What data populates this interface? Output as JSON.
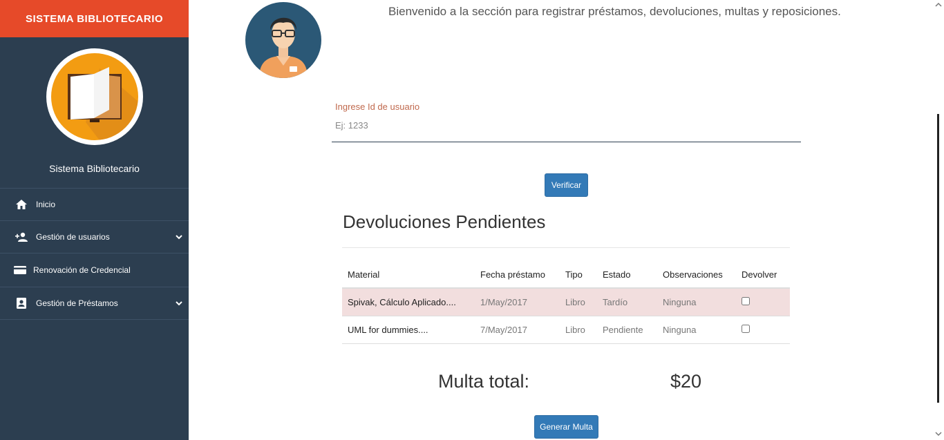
{
  "sidebar": {
    "brand": "SISTEMA BIBLIOTECARIO",
    "title": "Sistema Bibliotecario",
    "items": [
      {
        "label": "Inicio",
        "icon": "home-icon",
        "has_submenu": false
      },
      {
        "label": "Gestión de usuarios",
        "icon": "add-user-icon",
        "has_submenu": true
      },
      {
        "label": "Renovación de Credencial",
        "icon": "credit-card-icon",
        "has_submenu": false
      },
      {
        "label": "Gestión de Préstamos",
        "icon": "loan-icon",
        "has_submenu": true
      }
    ]
  },
  "main": {
    "welcome": "Bienvenido a la sección para registrar préstamos, devoluciones, multas y reposiciones.",
    "user_field": {
      "label": "Ingrese Id de usuario",
      "placeholder": "Ej: 1233",
      "value": ""
    },
    "verify_button": "Verificar",
    "section_title": "Devoluciones Pendientes",
    "table": {
      "headers": [
        "Material",
        "Fecha préstamo",
        "Tipo",
        "Estado",
        "Observaciones",
        "Devolver"
      ],
      "rows": [
        {
          "material": "Spivak, Cálculo Aplicado....",
          "fecha": "1/May/2017",
          "tipo": "Libro",
          "estado": "Tardío",
          "observaciones": "Ninguna",
          "devolver": false,
          "highlight": true
        },
        {
          "material": "UML for dummies....",
          "fecha": "7/May/2017",
          "tipo": "Libro",
          "estado": "Pendiente",
          "observaciones": "Ninguna",
          "devolver": false,
          "highlight": false
        }
      ]
    },
    "multa_label": "Multa total:",
    "multa_value": "$20",
    "generate_button": "Generar Multa"
  },
  "colors": {
    "brand": "#e64a29",
    "sidebar": "#2c3e50",
    "primary": "#337ab7",
    "danger_row": "#f2dede",
    "label": "#c0694d"
  }
}
